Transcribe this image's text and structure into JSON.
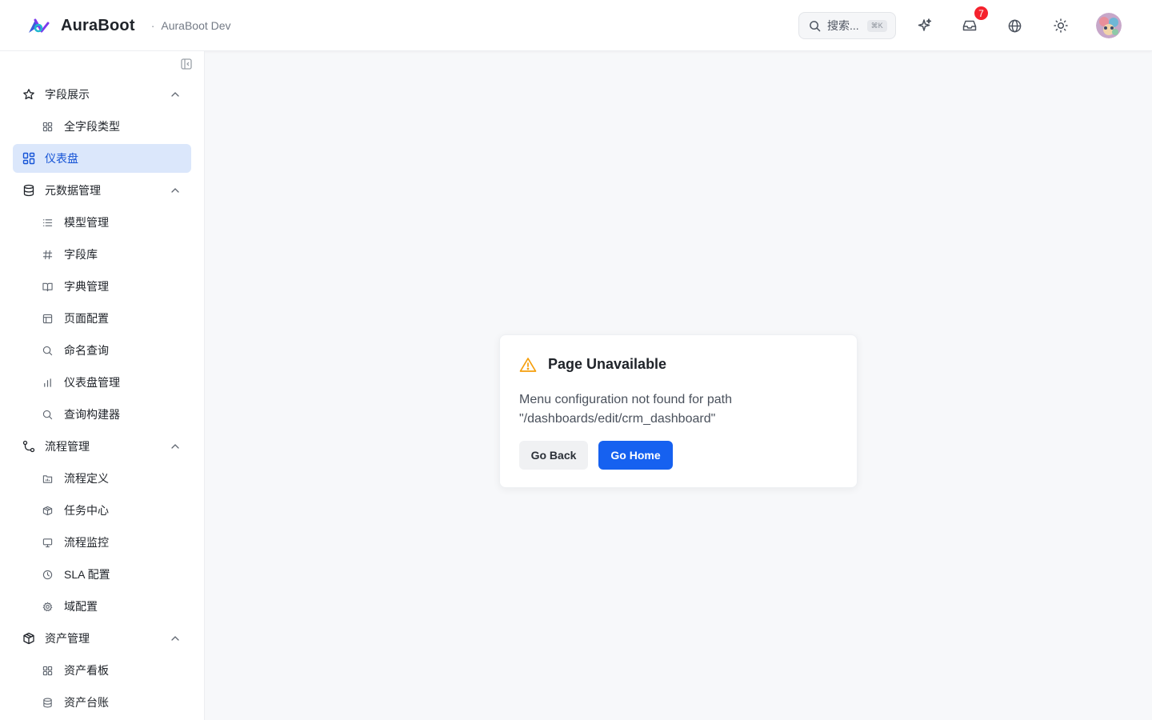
{
  "header": {
    "brand_name": "AuraBoot",
    "separator": "·",
    "env_name": "AuraBoot Dev",
    "search_placeholder": "搜索...",
    "search_shortcut": "⌘K",
    "notification_count": "7"
  },
  "sidebar": {
    "groups": [
      {
        "label": "字段展示",
        "icon": "star-icon",
        "items": [
          {
            "label": "全字段类型",
            "icon": "grid-icon"
          }
        ]
      },
      {
        "label": "仪表盘",
        "icon": "dashboard-icon",
        "active": true
      },
      {
        "label": "元数据管理",
        "icon": "database-icon",
        "items": [
          {
            "label": "模型管理",
            "icon": "list-icon"
          },
          {
            "label": "字段库",
            "icon": "hash-icon"
          },
          {
            "label": "字典管理",
            "icon": "book-icon"
          },
          {
            "label": "页面配置",
            "icon": "layout-icon"
          },
          {
            "label": "命名查询",
            "icon": "search-icon"
          },
          {
            "label": "仪表盘管理",
            "icon": "bar-chart-icon"
          },
          {
            "label": "查询构建器",
            "icon": "search-icon"
          }
        ]
      },
      {
        "label": "流程管理",
        "icon": "workflow-icon",
        "items": [
          {
            "label": "流程定义",
            "icon": "folder-chart-icon"
          },
          {
            "label": "任务中心",
            "icon": "package-icon"
          },
          {
            "label": "流程监控",
            "icon": "monitor-icon"
          },
          {
            "label": "SLA 配置",
            "icon": "clock-icon"
          },
          {
            "label": "域配置",
            "icon": "gear-icon"
          }
        ]
      },
      {
        "label": "资产管理",
        "icon": "box-icon",
        "items": [
          {
            "label": "资产看板",
            "icon": "grid-icon"
          },
          {
            "label": "资产台账",
            "icon": "database-icon"
          }
        ]
      }
    ]
  },
  "error_card": {
    "title": "Page Unavailable",
    "message": "Menu configuration not found for path \"/dashboards/edit/crm_dashboard\"",
    "back_label": "Go Back",
    "home_label": "Go Home"
  },
  "colors": {
    "accent": "#1661f0",
    "active_bg": "#dbe7fb",
    "active_text": "#1453d6",
    "warning": "#f59e0b",
    "badge": "#f5222d"
  }
}
